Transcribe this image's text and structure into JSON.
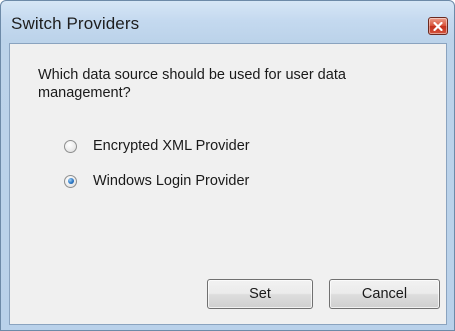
{
  "window": {
    "title": "Switch Providers",
    "close_icon": "close-icon"
  },
  "dialog": {
    "question": "Which data source should be used for user data management?",
    "options": [
      {
        "label": "Encrypted XML Provider",
        "selected": false
      },
      {
        "label": "Windows Login Provider",
        "selected": true
      }
    ],
    "buttons": {
      "set_label": "Set",
      "cancel_label": "Cancel"
    }
  },
  "colors": {
    "title_bar": "#c4d9ef",
    "close_button": "#d9553c",
    "client_background": "#f0f0f0",
    "radio_selected": "#2a76c4"
  }
}
